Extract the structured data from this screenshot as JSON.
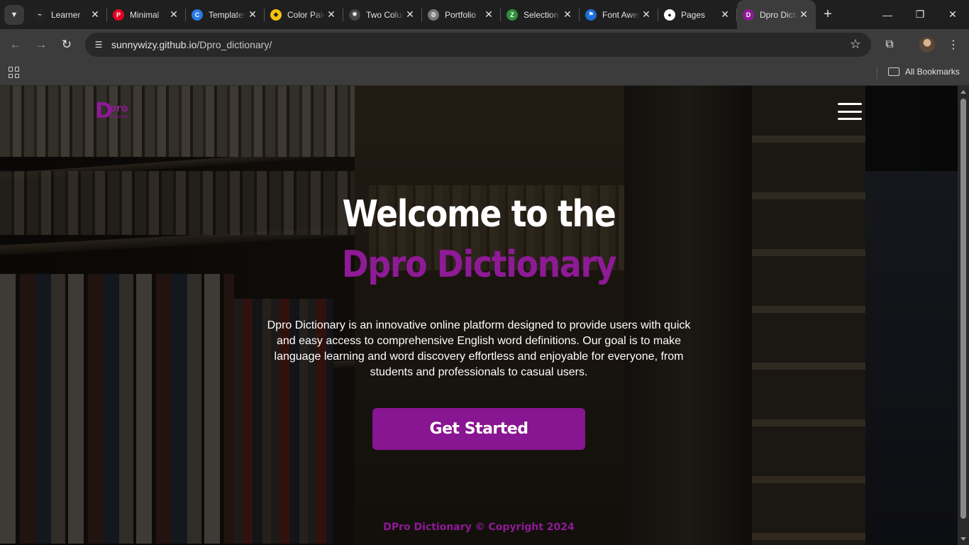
{
  "browser": {
    "tabs": [
      {
        "title": "Learner",
        "icon": "learner-icon",
        "color": "#222222",
        "glyph": "~"
      },
      {
        "title": "Minimal",
        "icon": "pinterest-icon",
        "color": "#e60023",
        "glyph": "P"
      },
      {
        "title": "Templates",
        "icon": "canva-icon",
        "color": "#2a7be4",
        "glyph": "C"
      },
      {
        "title": "Color Palette",
        "icon": "color-palette-icon",
        "color": "#f4c20d",
        "glyph": "◆"
      },
      {
        "title": "Two Column",
        "icon": "openai-icon",
        "color": "#444444",
        "glyph": "✺"
      },
      {
        "title": "Portfolio",
        "icon": "globe-icon",
        "color": "#777777",
        "glyph": "◍"
      },
      {
        "title": "Selection",
        "icon": "zoho-icon",
        "color": "#2d8f3a",
        "glyph": "Z"
      },
      {
        "title": "Font Awesome",
        "icon": "font-awesome-flag-icon",
        "color": "#1c6fd9",
        "glyph": "⚑"
      },
      {
        "title": "Pages",
        "icon": "github-icon",
        "color": "#ffffff",
        "glyph": "●"
      },
      {
        "title": "Dpro Dictionary",
        "icon": "dpro-favicon-icon",
        "color": "#8e1a96",
        "glyph": "D"
      }
    ],
    "active_tab_index": 9,
    "new_tab_label": "+",
    "url_host": "sunnywizy.github.io",
    "url_path": "/Dpro_dictionary/",
    "all_bookmarks_label": "All Bookmarks"
  },
  "site": {
    "logo_letter": "D",
    "logo_pro": "pro",
    "logo_sub": "Dictionary",
    "hero_line1": "Welcome to the",
    "hero_line2": "Dpro Dictionary",
    "intro": "Dpro Dictionary is an innovative online platform designed to provide users with quick and easy access to comprehensive English word definitions. Our goal is to make language learning and word discovery effortless and enjoyable for everyone, from students and professionals to casual users.",
    "cta_label": "Get Started",
    "footer": "DPro Dictionary © Copyright 2024"
  },
  "colors": {
    "brand_purple": "#8e1a96",
    "button_purple": "#881591",
    "hero_text": "#ffffff"
  }
}
